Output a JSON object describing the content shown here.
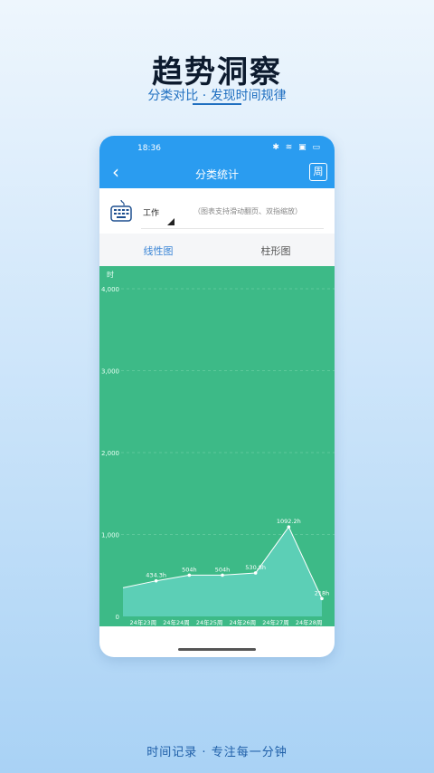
{
  "promo": {
    "title": "趋势洞察",
    "subtitle": "分类对比 · 发现时间规律",
    "footer": "时间记录 · 专注每一分钟"
  },
  "statusbar": {
    "time": "18:36",
    "icons": "✱ ≋ ▣ ▭"
  },
  "navbar": {
    "back_icon": "‹",
    "title": "分类统计",
    "period_label": "周"
  },
  "category": {
    "icon": "keyboard-icon",
    "label": "工作",
    "hint": "（图表支持滑动翻页、双指缩放）"
  },
  "tabs": [
    {
      "label": "线性图",
      "active": true
    },
    {
      "label": "柱形图",
      "active": false
    }
  ],
  "colors": {
    "accent": "#2a9cf0",
    "chart_bg": "#3dba87",
    "area_fill": "#5ccfb6",
    "tab_active": "#3c86d6"
  },
  "chart_data": {
    "type": "area",
    "ylabel": "时",
    "ylim": [
      0,
      4000
    ],
    "yticks": [
      "4,000",
      "3,000",
      "2,000",
      "1,000",
      "0"
    ],
    "ytick_values": [
      4000,
      3000,
      2000,
      1000,
      0
    ],
    "x_labels": [
      "24年23周",
      "24年24周",
      "24年25周",
      "24年26周",
      "24年27周",
      "24年28周"
    ],
    "points": [
      {
        "value": 350,
        "label": ""
      },
      {
        "value": 434.3,
        "label": "434.3h"
      },
      {
        "value": 504,
        "label": "504h"
      },
      {
        "value": 504,
        "label": "504h"
      },
      {
        "value": 530.8,
        "label": "530.8h"
      },
      {
        "value": 1092.2,
        "label": "1092.2h"
      },
      {
        "value": 218,
        "label": "218h"
      }
    ],
    "grid": true
  }
}
